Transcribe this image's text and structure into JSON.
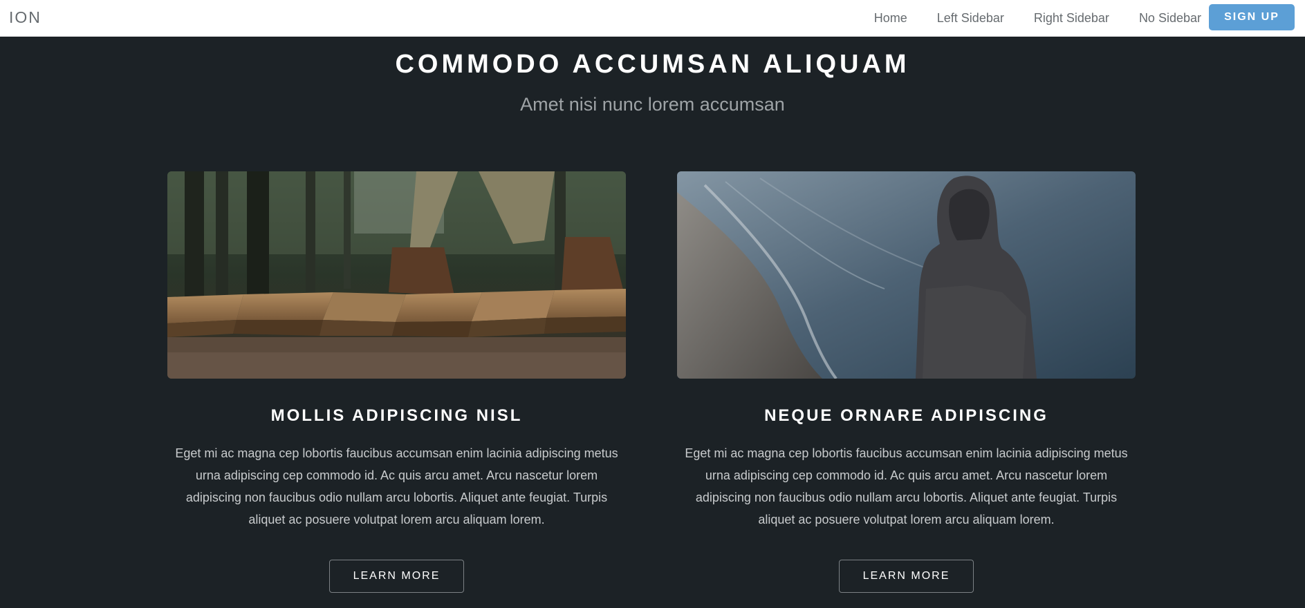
{
  "navbar": {
    "brand": "ION",
    "links": [
      "Home",
      "Left Sidebar",
      "Right Sidebar",
      "No Sidebar"
    ],
    "signup_label": "SIGN UP"
  },
  "hero": {
    "title": "COMMODO ACCUMSAN ALIQUAM",
    "subtitle": "Amet nisi nunc lorem accumsan"
  },
  "cards": [
    {
      "title": "MOLLIS ADIPISCING NISL",
      "text": "Eget mi ac magna cep lobortis faucibus accumsan enim lacinia adipiscing metus urna adipiscing cep commodo id. Ac quis arcu amet. Arcu nascetur lorem adipiscing non faucibus odio nullam arcu lobortis. Aliquet ante feugiat. Turpis aliquet ac posuere volutpat lorem arcu aliquam lorem.",
      "button": "LEARN MORE"
    },
    {
      "title": "NEQUE ORNARE ADIPISCING",
      "text": "Eget mi ac magna cep lobortis faucibus accumsan enim lacinia adipiscing metus urna adipiscing cep commodo id. Ac quis arcu amet. Arcu nascetur lorem adipiscing non faucibus odio nullam arcu lobortis. Aliquet ante feugiat. Turpis aliquet ac posuere volutpat lorem arcu aliquam lorem.",
      "button": "LEARN MORE"
    }
  ],
  "colors": {
    "background": "#1c2226",
    "accent": "#5c9fd6",
    "navbar": "#ffffff"
  }
}
